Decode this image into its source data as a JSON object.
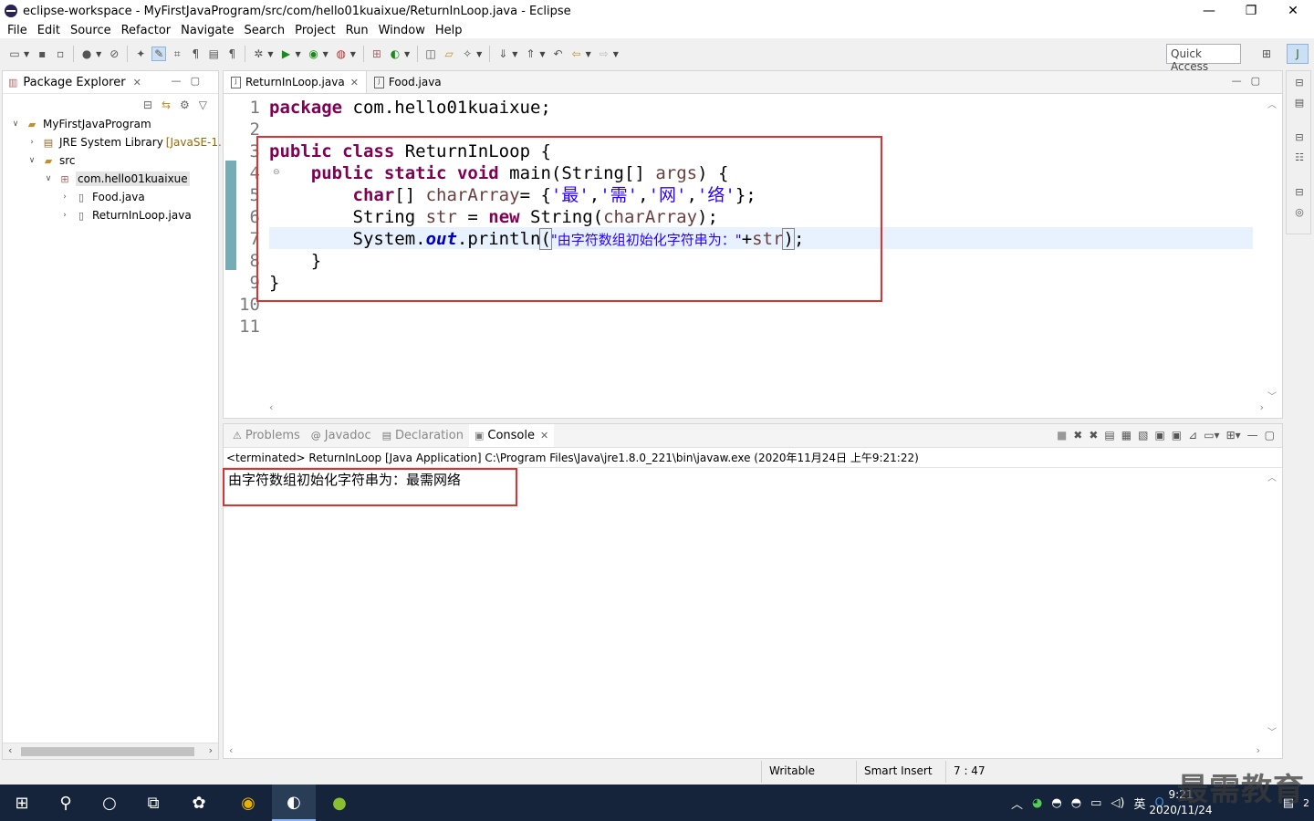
{
  "window": {
    "title": "eclipse-workspace - MyFirstJavaProgram/src/com/hello01kuaixue/ReturnInLoop.java - Eclipse",
    "minimize": "—",
    "maximize": "❐",
    "close": "✕"
  },
  "menu": [
    "File",
    "Edit",
    "Source",
    "Refactor",
    "Navigate",
    "Search",
    "Project",
    "Run",
    "Window",
    "Help"
  ],
  "toolbar": {
    "quick_access": "Quick Access"
  },
  "package_explorer": {
    "title": "Package Explorer",
    "tree": [
      {
        "label": "MyFirstJavaProgram",
        "twisty": "∨",
        "icon": "project-icon",
        "decoration": ""
      },
      {
        "label": "JRE System Library",
        "twisty": "›",
        "icon": "library-icon",
        "decoration": "[JavaSE-1."
      },
      {
        "label": "src",
        "twisty": "∨",
        "icon": "source-folder-icon",
        "decoration": ""
      },
      {
        "label": "com.hello01kuaixue",
        "twisty": "∨",
        "icon": "package-icon",
        "decoration": ""
      },
      {
        "label": "Food.java",
        "twisty": "›",
        "icon": "java-file-icon",
        "decoration": ""
      },
      {
        "label": "ReturnInLoop.java",
        "twisty": "›",
        "icon": "java-file-icon",
        "decoration": ""
      }
    ]
  },
  "editor": {
    "tabs": [
      {
        "label": "ReturnInLoop.java",
        "active": true
      },
      {
        "label": "Food.java",
        "active": false
      }
    ],
    "line_numbers": [
      "1",
      "2",
      "3",
      "4",
      "5",
      "6",
      "7",
      "8",
      "9",
      "10",
      "11"
    ],
    "code": {
      "l1_kw": "package",
      "l1_rest": " com.hello01kuaixue;",
      "l3_kw1": "public",
      "l3_kw2": "class",
      "l3_rest": " ReturnInLoop {",
      "l4_indent": "    ",
      "l4_kw1": "public",
      "l4_kw2": "static",
      "l4_kw3": "void",
      "l4_rest1": " main(String[] ",
      "l4_var": "args",
      "l4_rest2": ") {",
      "l5_indent": "        ",
      "l5_kw": "char",
      "l5_rest1": "[] ",
      "l5_var": "charArray",
      "l5_rest2": "= {",
      "l5_c1": "'最'",
      "l5_c2": "'需'",
      "l5_c3": "'网'",
      "l5_c4": "'络'",
      "l5_comma": ",",
      "l5_end": "};",
      "l6_indent": "        ",
      "l6_rest1": "String ",
      "l6_var1": "str",
      "l6_rest2": " = ",
      "l6_kw": "new",
      "l6_rest3": " String(",
      "l6_var2": "charArray",
      "l6_rest4": ");",
      "l7_indent": "        ",
      "l7_rest1": "System.",
      "l7_field": "out",
      "l7_rest2": ".println",
      "l7_paren_open": "(",
      "l7_str": "\"由字符数组初始化字符串为：\"",
      "l7_plus": "+",
      "l7_var": "str",
      "l7_paren_close": ")",
      "l7_end": ";",
      "l8": "    }",
      "l9": "}"
    }
  },
  "console": {
    "tabs": [
      {
        "label": "Problems",
        "icon": "⚠",
        "active": false
      },
      {
        "label": "Javadoc",
        "icon": "@",
        "active": false
      },
      {
        "label": "Declaration",
        "icon": "▤",
        "active": false
      },
      {
        "label": "Console",
        "icon": "▣",
        "active": true
      }
    ],
    "status": "<terminated> ReturnInLoop [Java Application] C:\\Program Files\\Java\\jre1.8.0_221\\bin\\javaw.exe (2020年11月24日 上午9:21:22)",
    "output": "由字符数组初始化字符串为：最需网络"
  },
  "statusbar": {
    "writable": "Writable",
    "insert_mode": "Smart Insert",
    "position": "7 : 47"
  },
  "taskbar": {
    "time": "9:21",
    "date": "2020/11/24",
    "ime": "英",
    "notification_count": "2"
  },
  "watermark": "最需教育"
}
